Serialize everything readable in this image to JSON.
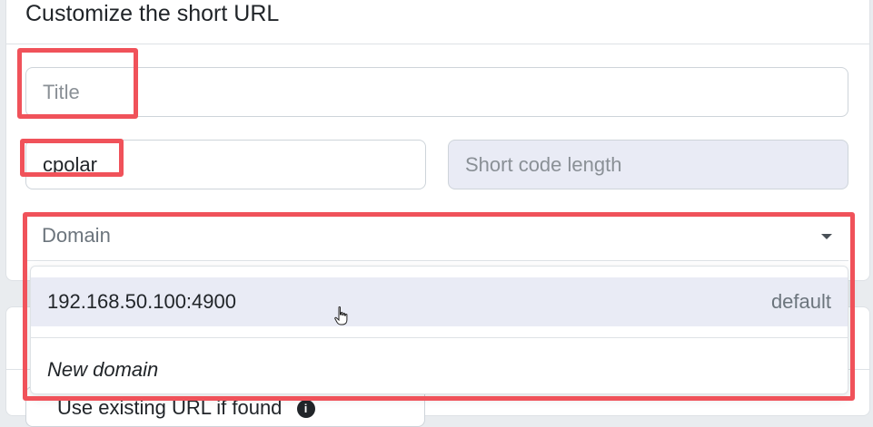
{
  "modal": {
    "title": "Customize the short URL"
  },
  "form": {
    "title_placeholder": "Title",
    "title_value": "",
    "custom_slug_value": "cpolar",
    "short_code_length_placeholder": "Short code length",
    "domain_placeholder": "Domain"
  },
  "domain_dropdown": {
    "options": [
      {
        "label": "192.168.50.100:4900",
        "badge": "default",
        "active": true
      },
      {
        "label": "New domain",
        "italic": true
      }
    ]
  },
  "below": {
    "existing_label": "Use existing URL if found",
    "info_icon": "info-circle-icon"
  },
  "colors": {
    "highlight": "#f0525a",
    "active_option_bg": "#e9ebf5",
    "disabled_field_bg": "#e9ebf5"
  }
}
